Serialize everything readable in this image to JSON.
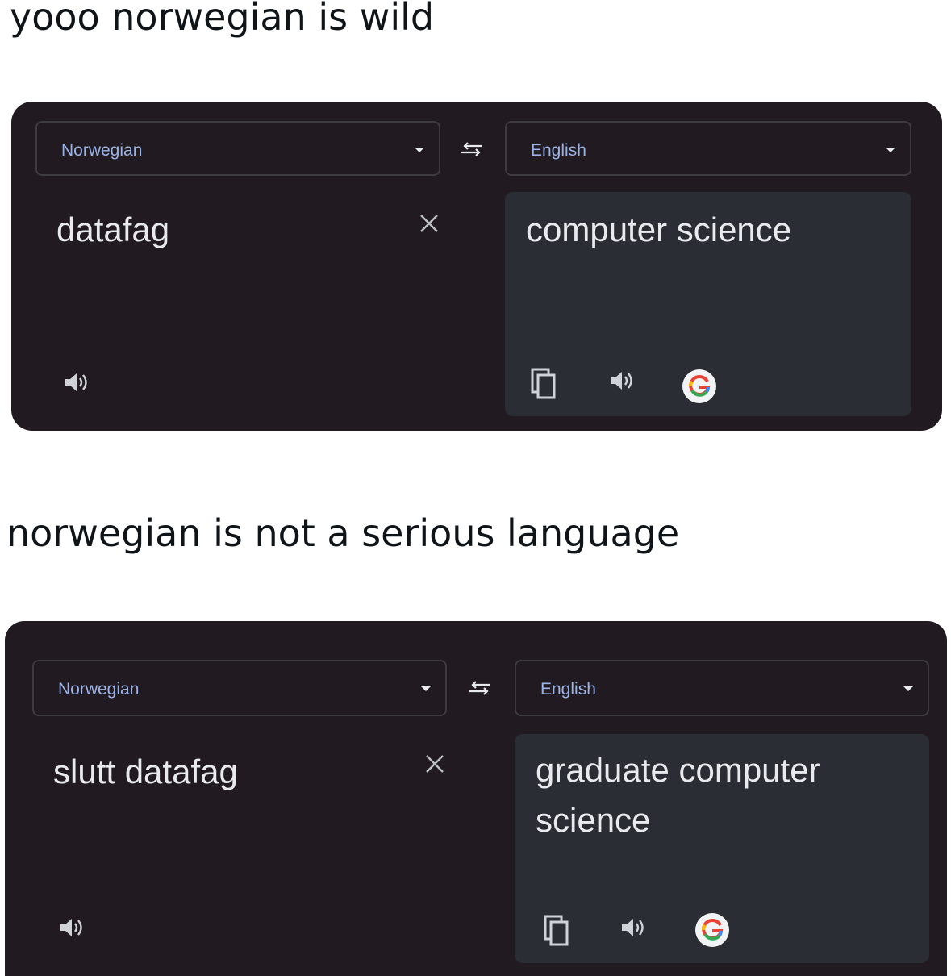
{
  "posts": [
    {
      "caption": "yooo norwegian is wild",
      "translator": {
        "source_language": "Norwegian",
        "target_language": "English",
        "source_text": "datafag",
        "translated_text": "computer science"
      }
    },
    {
      "caption": "norwegian is not a serious language",
      "translator": {
        "source_language": "Norwegian",
        "target_language": "English",
        "source_text": "slutt datafag",
        "translated_text": "graduate computer science"
      }
    }
  ],
  "icons": {
    "swap": "swap-languages-icon",
    "clear": "close-icon",
    "speaker": "speaker-icon",
    "copy": "copy-icon",
    "google": "google-g-icon",
    "dropdown": "chevron-down-icon"
  },
  "colors": {
    "panel_background": "#211b21",
    "output_background": "#2a2d33",
    "language_label": "#9ab3e6",
    "text": "#e8eaed"
  }
}
